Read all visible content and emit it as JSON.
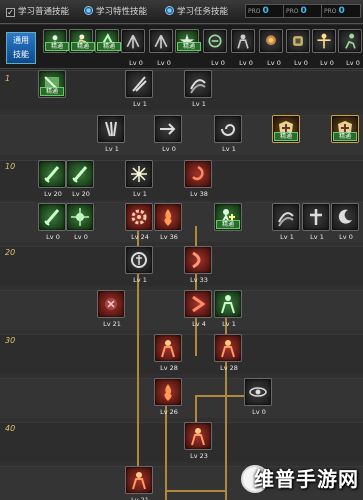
{
  "topbar": {
    "tabs": [
      {
        "label": "学习普通技能",
        "state": "check"
      },
      {
        "label": "学习特性技能",
        "state": "radio-on"
      },
      {
        "label": "学习任务技能",
        "state": "radio-on"
      }
    ],
    "counters": [
      {
        "label": "PRO",
        "value": "0"
      },
      {
        "label": "PRO",
        "value": "0"
      },
      {
        "label": "PRO",
        "value": "0"
      }
    ]
  },
  "quickbar": {
    "label_line1": "通用",
    "label_line2": "技能",
    "skills": [
      {
        "icon": "mage-icon",
        "badge": "精通",
        "tone": "green"
      },
      {
        "icon": "fighter-icon",
        "badge": "精通",
        "tone": "green"
      },
      {
        "icon": "rogue-icon",
        "badge": "精通",
        "tone": "green"
      },
      {
        "icon": "wing-icon",
        "level": "Lv 0"
      },
      {
        "icon": "wing-icon",
        "level": "Lv 0"
      },
      {
        "icon": "star-icon",
        "badge": "精通",
        "tone": "green"
      },
      {
        "icon": "armor-icon",
        "level": "Lv 0"
      },
      {
        "icon": "knight-icon",
        "level": "Lv 0"
      },
      {
        "icon": "monk-icon",
        "level": "Lv 0"
      },
      {
        "icon": "helm-icon",
        "level": "Lv 0"
      },
      {
        "icon": "warrior-icon",
        "level": "Lv 0"
      },
      {
        "icon": "runner-icon",
        "level": "Lv 0"
      }
    ]
  },
  "tree": {
    "rows": [
      "1",
      "10",
      "20",
      "30",
      "40"
    ],
    "skills": [
      {
        "icon": "book-icon",
        "badge": "精通",
        "tone": "green"
      },
      {
        "icon": "slash-icon",
        "level": "Lv 1"
      },
      {
        "icon": "wave-icon",
        "level": "Lv 1"
      },
      {
        "icon": "claw-icon",
        "level": "Lv 1"
      },
      {
        "icon": "arrow-icon",
        "level": "Lv 0"
      },
      {
        "icon": "vortex-icon",
        "level": "Lv 1"
      },
      {
        "icon": "shield-icon",
        "badge": "精通",
        "tone": "gold"
      },
      {
        "icon": "shield-icon",
        "badge": "精通",
        "tone": "gold"
      },
      {
        "icon": "sword-icon",
        "level": "Lv 20",
        "tone": "green"
      },
      {
        "icon": "sword-icon",
        "level": "Lv 20",
        "tone": "green"
      },
      {
        "icon": "burst-icon",
        "level": "Lv 1"
      },
      {
        "icon": "fire-swirl-icon",
        "level": "Lv 38",
        "tone": "red"
      },
      {
        "icon": "sword-icon",
        "level": "Lv 0",
        "tone": "green"
      },
      {
        "icon": "star-burst-icon",
        "level": "Lv 0",
        "tone": "green"
      },
      {
        "icon": "gear-icon",
        "level": "Lv 24",
        "tone": "red"
      },
      {
        "icon": "flame-icon",
        "level": "Lv 36",
        "tone": "red"
      },
      {
        "icon": "figure-plus-icon",
        "badge": "精通",
        "tone": "green"
      },
      {
        "icon": "wave-icon",
        "level": "Lv 1"
      },
      {
        "icon": "cross-icon",
        "level": "Lv 1"
      },
      {
        "icon": "moon-icon",
        "level": "Lv 0"
      },
      {
        "icon": "circle-rune-icon",
        "level": "Lv 1"
      },
      {
        "icon": "crescent-icon",
        "level": "Lv 33",
        "tone": "red"
      },
      {
        "icon": "rune-icon",
        "level": "Lv 21",
        "tone": "red"
      },
      {
        "icon": "chevron-icon",
        "level": "Lv 4",
        "tone": "red"
      },
      {
        "icon": "figure-icon",
        "level": "Lv 1",
        "tone": "green"
      },
      {
        "icon": "fire-figure-icon",
        "level": "Lv 28",
        "tone": "red"
      },
      {
        "icon": "fire-figure-icon",
        "level": "Lv 28",
        "tone": "red"
      },
      {
        "icon": "flame-icon",
        "level": "Lv 26",
        "tone": "red"
      },
      {
        "icon": "eye-icon",
        "level": "Lv 0"
      },
      {
        "icon": "fire-figure-icon",
        "level": "Lv 23",
        "tone": "red"
      },
      {
        "icon": "fire-figure-icon",
        "level": "Lv 21",
        "tone": "red"
      }
    ]
  },
  "watermark": {
    "text": "维普手游网"
  }
}
